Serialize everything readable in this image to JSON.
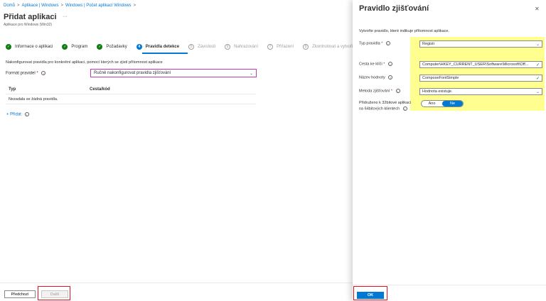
{
  "breadcrumb": [
    "Domů",
    "Aplikace | Windows",
    "Windows | Počet aplikací Windows"
  ],
  "page": {
    "title": "Přidat aplikaci",
    "more": "···",
    "subtitle": "Aplikace pro Windows (Win32)"
  },
  "steps": [
    {
      "label": "Informace o aplikaci",
      "state": "done"
    },
    {
      "label": "Program",
      "state": "done"
    },
    {
      "label": "Požadavky",
      "state": "done"
    },
    {
      "label": "Pravidla detekce",
      "state": "active",
      "num": "4"
    },
    {
      "label": "Závislosti",
      "state": "pending",
      "num": "5"
    },
    {
      "label": "Nahrazování",
      "state": "pending",
      "num": "6"
    },
    {
      "label": "Přiřazení",
      "state": "pending",
      "num": "7"
    },
    {
      "label": "Zkontrolovat a vytvořit",
      "state": "pending",
      "num": "8"
    }
  ],
  "detection": {
    "description": "Nakonfigurovat pravidla pro konkrétní aplikaci, pomocí kterých se zjistí přítomnost aplikace",
    "format_label": "Formát pravidel",
    "format_value": "Ručně nakonfigurovat pravidla zjišťování",
    "columns": [
      "Typ",
      "Cesta/kód"
    ],
    "empty_text": "Nezadala se žádná pravidla.",
    "add_label": "+ Přidat"
  },
  "footer": {
    "prev_label": "Předchozí",
    "next_label": "Další"
  },
  "panel": {
    "title": "Pravidlo zjišťování",
    "description": "Vytvořte pravidlo, které indikuje přítomnost aplikace.",
    "rule_type_label": "Typ pravidla",
    "rule_type_value": "Registr",
    "key_path_label": "Cesta ke klíči",
    "key_path_value": "Computer\\HKEY_CURRENT_USER\\Software\\Microsoft\\Off...",
    "value_name_label": "Název hodnoty",
    "value_name_value": "ComposeFontSimple",
    "method_label": "Metoda zjišťování",
    "method_value": "Hodnota existuje.",
    "assoc_label_1": "Přidruženo k 32bitové aplikaci",
    "assoc_label_2": "na 64bitových klientech",
    "toggle_yes": "Ano",
    "toggle_no": "Ne",
    "ok_label": "OK"
  },
  "colors": {
    "accent": "#0078d4",
    "success": "#107c10",
    "highlight": "#ffff8f",
    "annotation": "#e81123"
  }
}
